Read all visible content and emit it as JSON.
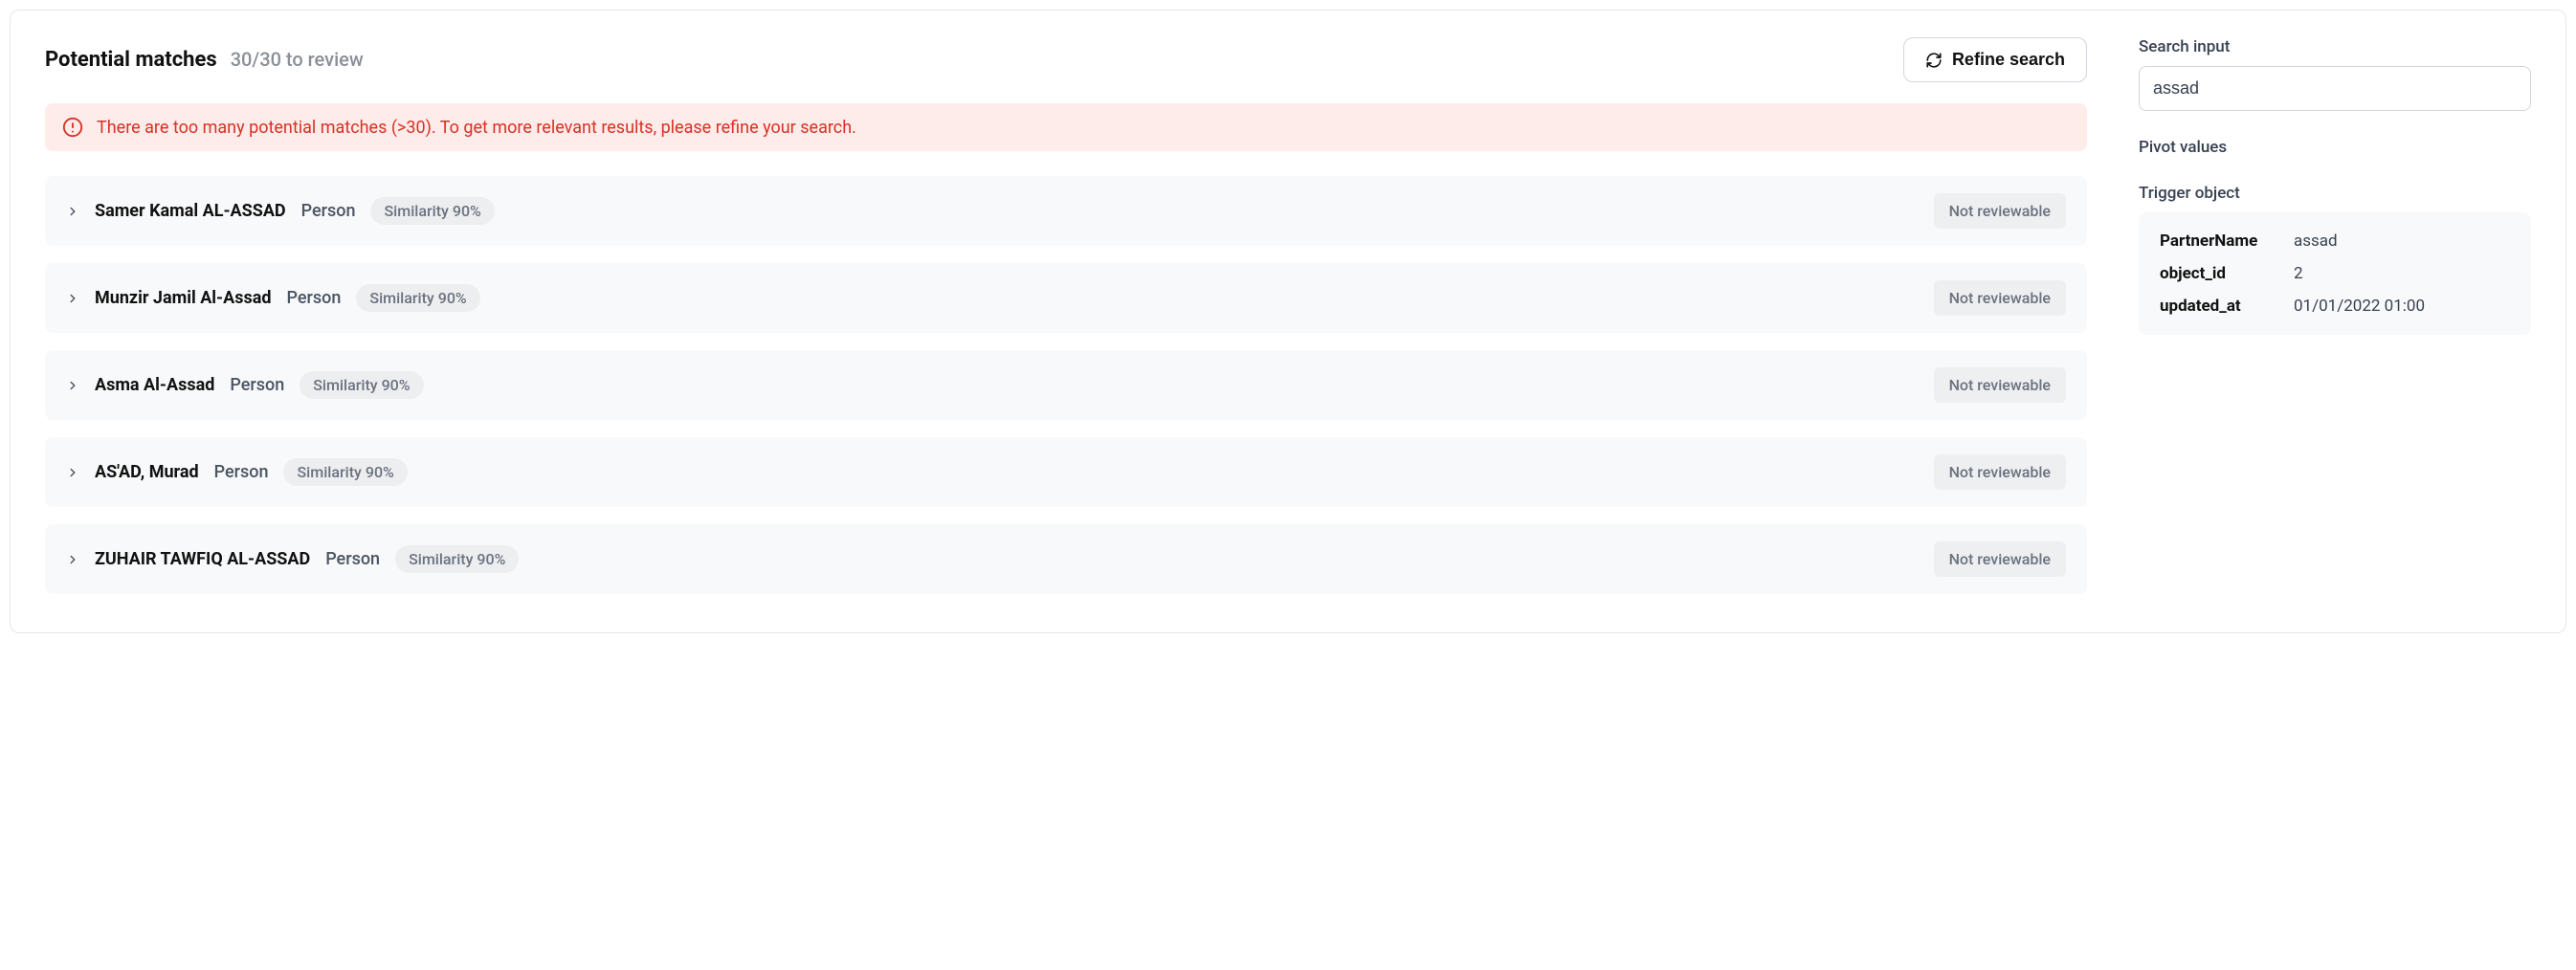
{
  "header": {
    "title": "Potential matches",
    "count_text": "30/30 to review",
    "refine_label": "Refine search"
  },
  "alert": {
    "text": "There are too many potential matches (>30). To get more relevant results, please refine your search."
  },
  "matches": [
    {
      "name": "Samer Kamal AL-ASSAD",
      "type": "Person",
      "similarity": "Similarity 90%",
      "status": "Not reviewable"
    },
    {
      "name": "Munzir Jamil Al-Assad",
      "type": "Person",
      "similarity": "Similarity 90%",
      "status": "Not reviewable"
    },
    {
      "name": "Asma Al-Assad",
      "type": "Person",
      "similarity": "Similarity 90%",
      "status": "Not reviewable"
    },
    {
      "name": "AS'AD, Murad",
      "type": "Person",
      "similarity": "Similarity 90%",
      "status": "Not reviewable"
    },
    {
      "name": "ZUHAIR TAWFIQ AL-ASSAD",
      "type": "Person",
      "similarity": "Similarity 90%",
      "status": "Not reviewable"
    }
  ],
  "sidebar": {
    "search_label": "Search input",
    "search_value": "assad",
    "pivot_label": "Pivot values",
    "trigger_label": "Trigger object",
    "trigger_rows": [
      {
        "key": "PartnerName",
        "value": "assad"
      },
      {
        "key": "object_id",
        "value": "2"
      },
      {
        "key": "updated_at",
        "value": "01/01/2022 01:00"
      }
    ]
  }
}
